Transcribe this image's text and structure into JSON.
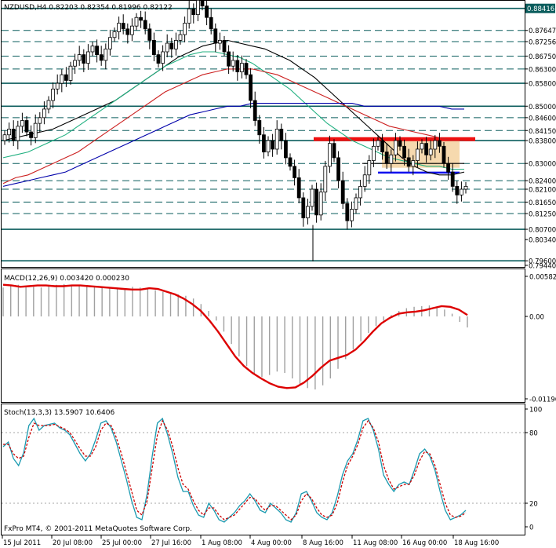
{
  "window": {
    "main_title": "NZDUSD,H4  0.82203  0.82354  0.81996  0.82122",
    "macd_title": "MACD(12,26,9)  0.003420  0.000230",
    "stoch_title": "Stoch(13,3,3) 13.5907 10.6406",
    "copyright": "FxPro MT4, © 2001-2011 MetaQuotes Software Corp."
  },
  "chart_data": [
    {
      "type": "candlestick",
      "panel": "price",
      "symbol": "NZDUSD",
      "timeframe": "H4",
      "ylim": [
        0.7944,
        0.886
      ],
      "price_labels": [
        {
          "value": 0.88416,
          "label": "0.88416",
          "highlight": true
        },
        {
          "value": 0.87647,
          "label": "0.87647",
          "highlight": false
        },
        {
          "value": 0.87256,
          "label": "0.87256",
          "highlight": false
        },
        {
          "value": 0.8675,
          "label": "0.86750",
          "highlight": false
        },
        {
          "value": 0.863,
          "label": "0.86300",
          "highlight": false
        },
        {
          "value": 0.858,
          "label": "0.85800",
          "highlight": false
        },
        {
          "value": 0.85,
          "label": "0.85000",
          "highlight": false
        },
        {
          "value": 0.846,
          "label": "0.84600",
          "highlight": false
        },
        {
          "value": 0.8415,
          "label": "0.84150",
          "highlight": false
        },
        {
          "value": 0.838,
          "label": "0.83800",
          "highlight": false
        },
        {
          "value": 0.83,
          "label": "0.83000",
          "highlight": false
        },
        {
          "value": 0.824,
          "label": "0.82400",
          "highlight": false
        },
        {
          "value": 0.821,
          "label": "0.82100",
          "highlight": false
        },
        {
          "value": 0.8165,
          "label": "0.81650",
          "highlight": false
        },
        {
          "value": 0.8125,
          "label": "0.81250",
          "highlight": false
        },
        {
          "value": 0.807,
          "label": "0.80700",
          "highlight": false
        },
        {
          "value": 0.8034,
          "label": "0.80340",
          "highlight": false
        },
        {
          "value": 0.796,
          "label": "0.79600",
          "highlight": false
        },
        {
          "value": 0.7944,
          "label": "0.79440",
          "highlight": false
        }
      ],
      "support_resistance_solid": [
        0.88416,
        0.858,
        0.85,
        0.838,
        0.807,
        0.796
      ],
      "support_resistance_dashed": [
        0.87647,
        0.87256,
        0.8675,
        0.863,
        0.846,
        0.8415,
        0.83,
        0.824,
        0.821,
        0.8165,
        0.8125
      ],
      "close_series": [
        0.84,
        0.842,
        0.838,
        0.843,
        0.845,
        0.841,
        0.839,
        0.844,
        0.846,
        0.849,
        0.852,
        0.856,
        0.858,
        0.861,
        0.859,
        0.864,
        0.866,
        0.868,
        0.865,
        0.869,
        0.871,
        0.868,
        0.866,
        0.87,
        0.874,
        0.876,
        0.879,
        0.877,
        0.875,
        0.878,
        0.881,
        0.88,
        0.877,
        0.873,
        0.868,
        0.865,
        0.869,
        0.872,
        0.87,
        0.873,
        0.875,
        0.879,
        0.884,
        0.882,
        0.887,
        0.885,
        0.881,
        0.877,
        0.872,
        0.873,
        0.869,
        0.864,
        0.866,
        0.862,
        0.865,
        0.861,
        0.852,
        0.845,
        0.84,
        0.834,
        0.838,
        0.835,
        0.842,
        0.838,
        0.832,
        0.829,
        0.825,
        0.818,
        0.811,
        0.815,
        0.821,
        0.812,
        0.82,
        0.829,
        0.837,
        0.832,
        0.824,
        0.816,
        0.81,
        0.814,
        0.818,
        0.822,
        0.826,
        0.831,
        0.836,
        0.838,
        0.834,
        0.83,
        0.833,
        0.838,
        0.836,
        0.832,
        0.829,
        0.831,
        0.835,
        0.837,
        0.833,
        0.835,
        0.838,
        0.836,
        0.83,
        0.827,
        0.822,
        0.819,
        0.821,
        0.822
      ],
      "moving_averages": [
        {
          "color": "#000000",
          "values": [
            0.838,
            0.839,
            0.84,
            0.841,
            0.842,
            0.844,
            0.846,
            0.848,
            0.85,
            0.852,
            0.855,
            0.858,
            0.861,
            0.864,
            0.867,
            0.869,
            0.871,
            0.872,
            0.873,
            0.872,
            0.871,
            0.87,
            0.868,
            0.866,
            0.863,
            0.86,
            0.856,
            0.852,
            0.848,
            0.844,
            0.84,
            0.836,
            0.832,
            0.829,
            0.827,
            0.826,
            0.826,
            0.827
          ]
        },
        {
          "color": "#20b080",
          "values": [
            0.832,
            0.833,
            0.834,
            0.836,
            0.838,
            0.84,
            0.843,
            0.846,
            0.849,
            0.852,
            0.855,
            0.858,
            0.861,
            0.864,
            0.866,
            0.868,
            0.869,
            0.869,
            0.868,
            0.867,
            0.865,
            0.862,
            0.859,
            0.856,
            0.852,
            0.848,
            0.844,
            0.841,
            0.838,
            0.836,
            0.834,
            0.832,
            0.831,
            0.83,
            0.829,
            0.829,
            0.828,
            0.828
          ]
        },
        {
          "color": "#cc2020",
          "values": [
            0.823,
            0.825,
            0.826,
            0.828,
            0.83,
            0.832,
            0.834,
            0.837,
            0.84,
            0.843,
            0.846,
            0.849,
            0.852,
            0.855,
            0.857,
            0.859,
            0.861,
            0.862,
            0.863,
            0.863,
            0.863,
            0.862,
            0.861,
            0.859,
            0.857,
            0.855,
            0.853,
            0.851,
            0.849,
            0.847,
            0.845,
            0.843,
            0.842,
            0.841,
            0.84,
            0.839,
            0.838,
            0.838
          ]
        },
        {
          "color": "#0000aa",
          "values": [
            0.822,
            0.823,
            0.824,
            0.825,
            0.826,
            0.827,
            0.829,
            0.831,
            0.833,
            0.835,
            0.837,
            0.839,
            0.841,
            0.843,
            0.845,
            0.847,
            0.848,
            0.849,
            0.85,
            0.85,
            0.851,
            0.851,
            0.851,
            0.851,
            0.851,
            0.851,
            0.851,
            0.851,
            0.851,
            0.85,
            0.85,
            0.85,
            0.85,
            0.85,
            0.85,
            0.85,
            0.849,
            0.849
          ]
        }
      ],
      "annotations": {
        "red_band_price": 0.8385,
        "blue_line_price": 0.8268,
        "black_line_price": 0.83,
        "box_range": [
          0.8285,
          0.8385
        ]
      }
    },
    {
      "type": "histogram+line",
      "panel": "macd",
      "ylim": [
        -0.01196,
        0.00582
      ],
      "tick_labels": [
        "0.00582",
        "0.00",
        "-0.01196"
      ],
      "tick_values": [
        0.00582,
        0.0,
        -0.01196
      ],
      "histogram": [
        0.0042,
        0.0045,
        0.0046,
        0.0044,
        0.0043,
        0.0042,
        0.0044,
        0.0046,
        0.0047,
        0.0046,
        0.0045,
        0.0044,
        0.0043,
        0.0042,
        0.0041,
        0.004,
        0.0041,
        0.0043,
        0.0042,
        0.004,
        0.0038,
        0.0036,
        0.0034,
        0.0032,
        0.003,
        0.0026,
        0.0018,
        0.0008,
        -0.0006,
        -0.0022,
        -0.004,
        -0.0058,
        -0.0072,
        -0.0083,
        -0.0088,
        -0.0085,
        -0.008,
        -0.0082,
        -0.009,
        -0.0098,
        -0.0104,
        -0.0106,
        -0.01,
        -0.009,
        -0.0076,
        -0.0062,
        -0.0048,
        -0.0036,
        -0.0024,
        -0.0014,
        -0.0006,
        0.0002,
        0.0008,
        0.0012,
        0.0014,
        0.0015,
        0.0016,
        0.0014,
        0.001,
        0.0004,
        -0.0008,
        -0.0016
      ],
      "signal": [
        0.0046,
        0.0045,
        0.0043,
        0.0044,
        0.0045,
        0.0045,
        0.0044,
        0.0044,
        0.0045,
        0.0045,
        0.0044,
        0.0043,
        0.0042,
        0.0041,
        0.004,
        0.0039,
        0.0039,
        0.0041,
        0.004,
        0.0036,
        0.0032,
        0.0026,
        0.0018,
        0.0008,
        -0.0006,
        -0.0022,
        -0.004,
        -0.0058,
        -0.0072,
        -0.0082,
        -0.009,
        -0.0097,
        -0.0102,
        -0.0104,
        -0.0103,
        -0.0096,
        -0.0086,
        -0.0074,
        -0.0064,
        -0.006,
        -0.0056,
        -0.0048,
        -0.0036,
        -0.0022,
        -0.001,
        -0.0002,
        0.0004,
        0.0006,
        0.0007,
        0.0009,
        0.0012,
        0.0015,
        0.0014,
        0.001,
        0.0002
      ],
      "signal_color": "#dd0000"
    },
    {
      "type": "line",
      "panel": "stochastic",
      "ylim": [
        0,
        100
      ],
      "tick_labels": [
        "100",
        "80",
        "20",
        "0"
      ],
      "tick_values": [
        100,
        80,
        20,
        0
      ],
      "main_color": "#1a9ab0",
      "signal_color": "#cc0000",
      "main": [
        68,
        72,
        58,
        52,
        63,
        86,
        92,
        82,
        86,
        87,
        88,
        84,
        82,
        78,
        70,
        62,
        56,
        62,
        74,
        88,
        90,
        84,
        72,
        56,
        40,
        22,
        8,
        6,
        28,
        60,
        88,
        92,
        78,
        62,
        42,
        30,
        30,
        18,
        10,
        8,
        20,
        14,
        6,
        4,
        8,
        12,
        18,
        22,
        28,
        22,
        14,
        12,
        20,
        16,
        12,
        6,
        4,
        12,
        28,
        30,
        22,
        12,
        8,
        6,
        12,
        26,
        44,
        56,
        62,
        74,
        90,
        92,
        82,
        66,
        44,
        36,
        30,
        36,
        38,
        36,
        48,
        62,
        66,
        60,
        48,
        30,
        14,
        6,
        8,
        10,
        14
      ],
      "signal": [
        70,
        70,
        62,
        58,
        60,
        76,
        88,
        86,
        86,
        86,
        87,
        85,
        83,
        80,
        73,
        66,
        60,
        60,
        68,
        82,
        88,
        86,
        76,
        62,
        46,
        30,
        14,
        10,
        22,
        50,
        78,
        90,
        82,
        68,
        50,
        36,
        32,
        22,
        14,
        10,
        16,
        16,
        10,
        6,
        8,
        10,
        15,
        20,
        25,
        24,
        18,
        14,
        18,
        18,
        14,
        10,
        6,
        10,
        22,
        28,
        24,
        16,
        10,
        8,
        10,
        20,
        38,
        52,
        60,
        70,
        84,
        90,
        84,
        72,
        52,
        40,
        32,
        34,
        36,
        36,
        44,
        56,
        64,
        62,
        52,
        36,
        20,
        10,
        8,
        9,
        12
      ]
    }
  ],
  "x_axis": {
    "labels": [
      "15 Jul 2011",
      "20 Jul 08:00",
      "25 Jul 00:00",
      "27 Jul 16:00",
      "1 Aug 08:00",
      "4 Aug 00:00",
      "8 Aug 16:00",
      "11 Aug 08:00",
      "16 Aug 00:00",
      "18 Aug 16:00"
    ]
  }
}
